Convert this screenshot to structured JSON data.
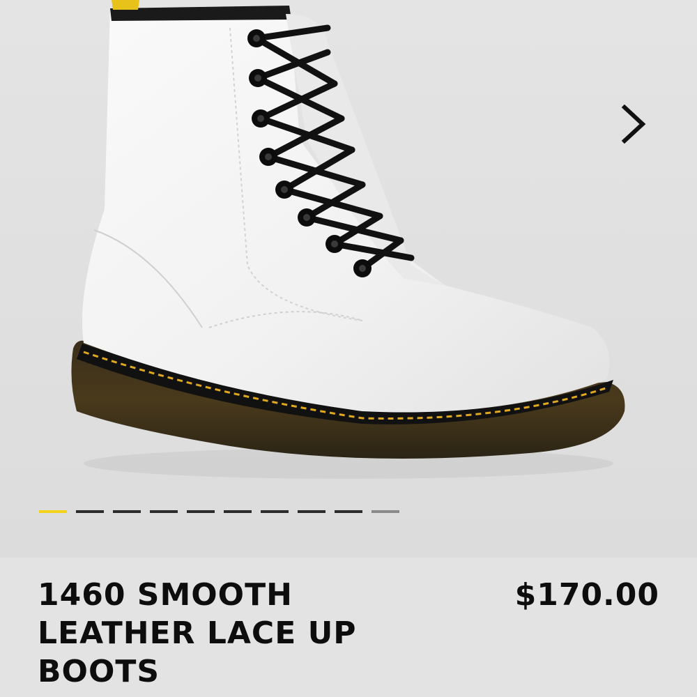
{
  "gallery": {
    "image_subject": "white-leather-boot",
    "next_icon": "chevron-right-icon",
    "slide_count": 10,
    "active_slide": 1,
    "colors": {
      "active_indicator": "#f2d21a",
      "inactive_indicator": "#2c2c2c",
      "last_indicator": "#8a8a8a"
    }
  },
  "product": {
    "title": "1460 SMOOTH LEATHER LACE UP BOOTS",
    "price": "$170.00"
  }
}
